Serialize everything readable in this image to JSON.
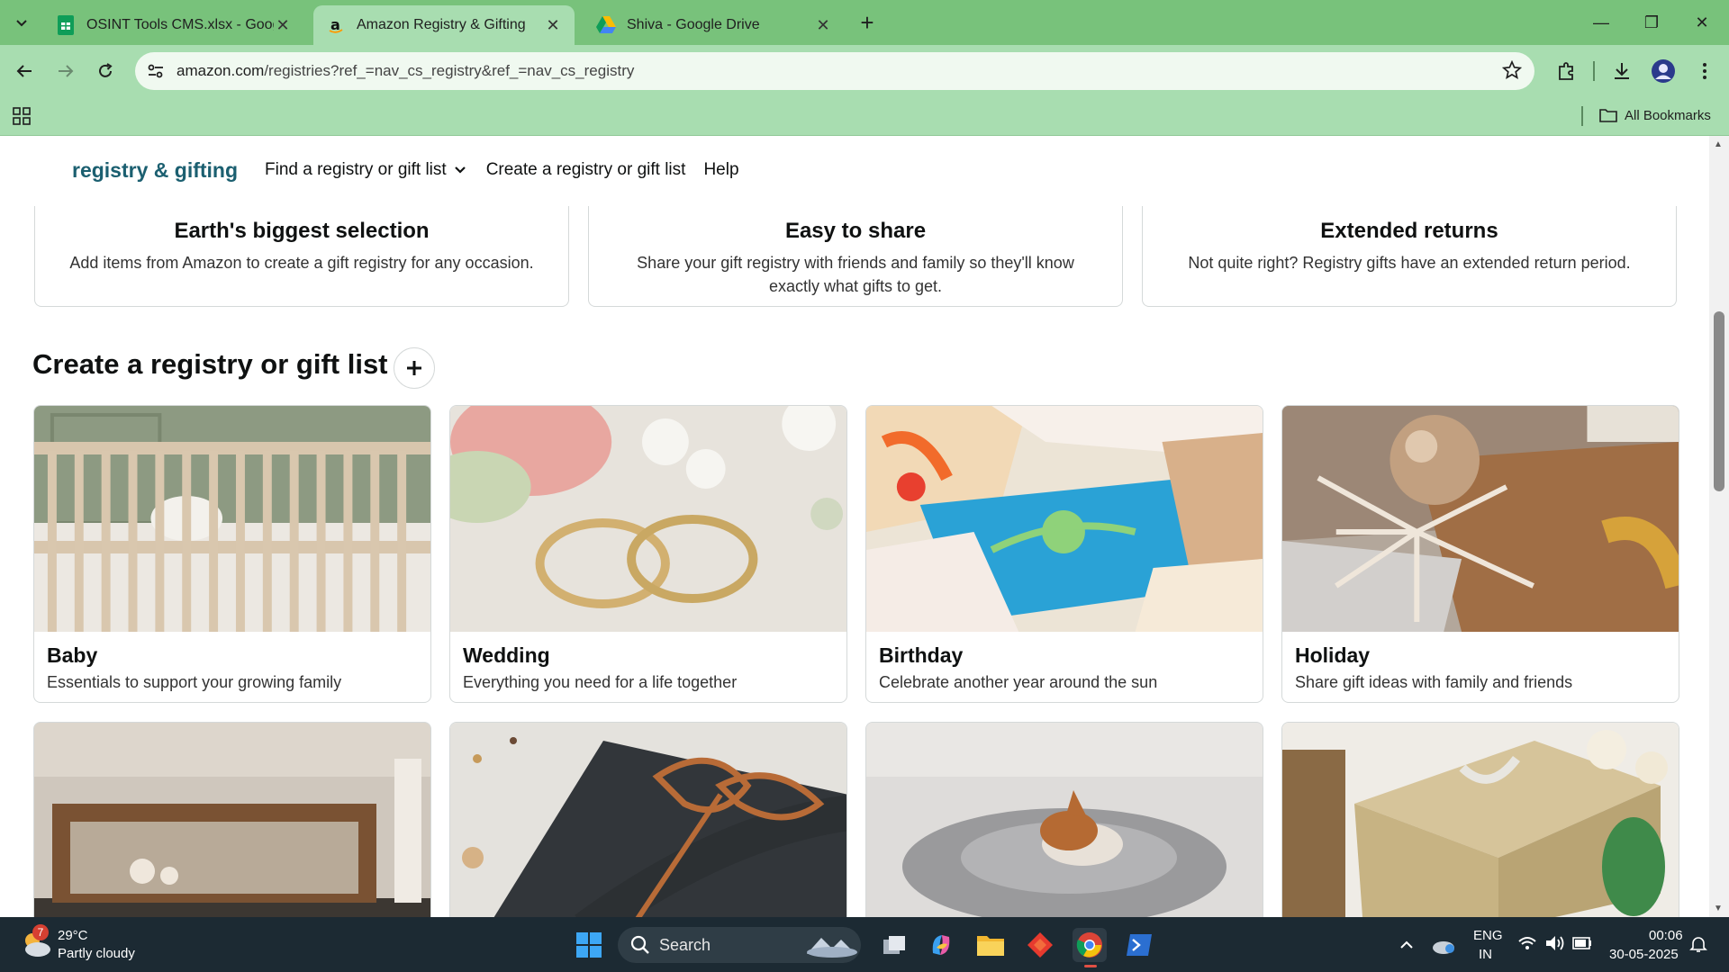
{
  "browser": {
    "tabs": [
      {
        "title": "OSINT Tools CMS.xlsx - Google",
        "active": false
      },
      {
        "title": "Amazon Registry & Gifting",
        "active": true
      },
      {
        "title": "Shiva - Google Drive",
        "active": false
      }
    ],
    "url": {
      "host": "amazon.com",
      "path": "/registries?ref_=nav_cs_registry&ref_=nav_cs_registry"
    },
    "bookmarks_label": "All Bookmarks"
  },
  "subnav": {
    "brand": "registry & gifting",
    "find": "Find a registry or gift list",
    "create": "Create a registry or gift list",
    "help": "Help"
  },
  "features": [
    {
      "title": "Earth's biggest selection",
      "text": "Add items from Amazon to create a gift registry for any occasion."
    },
    {
      "title": "Easy to share",
      "text": "Share your gift registry with friends and family so they'll know exactly what gifts to get."
    },
    {
      "title": "Extended returns",
      "text": "Not quite right? Registry gifts have an extended return period."
    }
  ],
  "section": {
    "title": "Create a registry or gift list"
  },
  "cards": [
    {
      "name": "Baby",
      "desc": "Essentials to support your growing family"
    },
    {
      "name": "Wedding",
      "desc": "Everything you need for a life together"
    },
    {
      "name": "Birthday",
      "desc": "Celebrate another year around the sun"
    },
    {
      "name": "Holiday",
      "desc": "Share gift ideas with family and friends"
    }
  ],
  "taskbar": {
    "weather_temp": "29°C",
    "weather_text": "Partly cloudy",
    "weather_badge": "7",
    "search_label": "Search",
    "lang1": "ENG",
    "lang2": "IN",
    "time": "00:06",
    "date": "30-05-2025"
  },
  "colors": {
    "tab_bar": "#78c27b",
    "toolbar": "#a8ddb0",
    "brand": "#1b5f70",
    "taskbar": "#1c2a33"
  }
}
